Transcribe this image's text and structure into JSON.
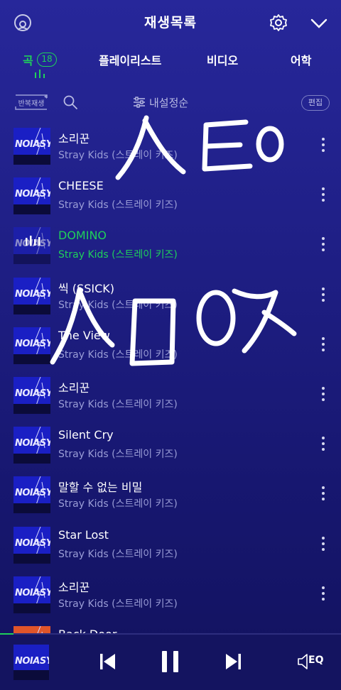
{
  "header": {
    "title": "재생목록",
    "left_icon": "user-circle-icon",
    "settings_icon": "gear-icon",
    "collapse_icon": "chevron-down-icon"
  },
  "tabs": [
    {
      "label": "곡",
      "count": "18",
      "active": true
    },
    {
      "label": "플레이리스트",
      "active": false
    },
    {
      "label": "비디오",
      "active": false
    },
    {
      "label": "어학",
      "active": false
    }
  ],
  "toolbar": {
    "repeat_label": "반복재생",
    "sort_label": "내설정순",
    "edit_label": "편집"
  },
  "songs": [
    {
      "title": "소리꾼",
      "artist": "Stray Kids (스트레이 키즈)"
    },
    {
      "title": "CHEESE",
      "artist": "Stray Kids (스트레이 키즈)"
    },
    {
      "title": "DOMINO",
      "artist": "Stray Kids (스트레이 키즈)",
      "playing": true
    },
    {
      "title": "씩 (SSICK)",
      "artist": "Stray Kids (스트레이 키즈)"
    },
    {
      "title": "The View",
      "artist": "Stray Kids (스트레이 키즈)"
    },
    {
      "title": "소리꾼",
      "artist": "Stray Kids (스트레이 키즈)"
    },
    {
      "title": "Silent Cry",
      "artist": "Stray Kids (스트레이 키즈)"
    },
    {
      "title": "말할 수 없는 비밀",
      "artist": "Stray Kids (스트레이 키즈)"
    },
    {
      "title": "Star Lost",
      "artist": "Stray Kids (스트레이 키즈)"
    },
    {
      "title": "소리꾼",
      "artist": "Stray Kids (스트레이 키즈)"
    },
    {
      "title": "Back Door",
      "artist": ""
    }
  ],
  "album_art_text": "NOIASY",
  "player": {
    "progress": 0.04,
    "controls": [
      "skip-previous-icon",
      "pause-icon",
      "skip-next-icon"
    ],
    "eq_label": "EQ"
  },
  "colors": {
    "accent": "#1fd05a",
    "background_top": "#27279a",
    "background_bottom": "#12125e",
    "secondary_text": "#9a9dd6"
  }
}
